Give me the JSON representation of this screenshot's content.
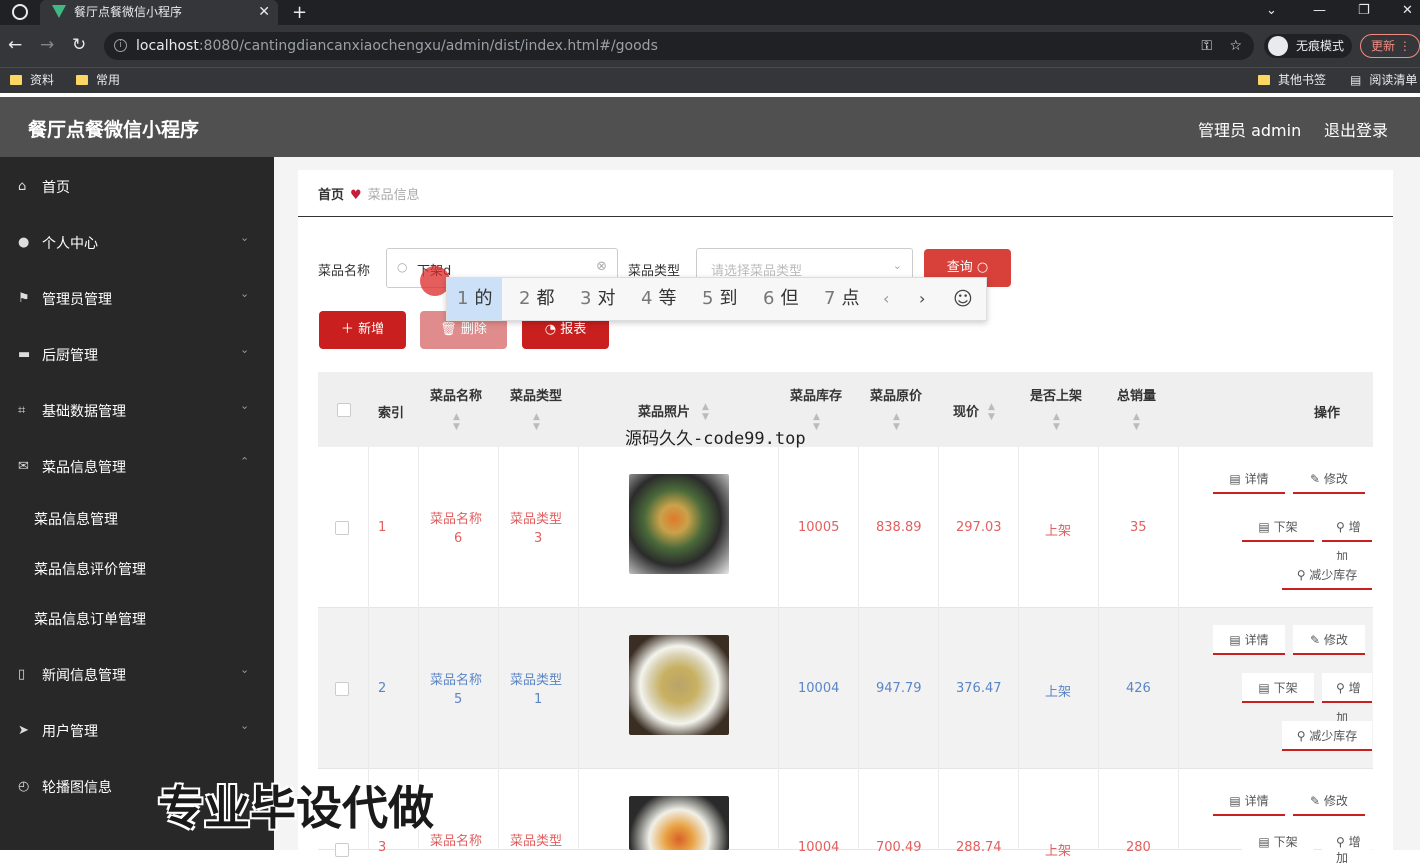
{
  "browser": {
    "tab_title": "餐厅点餐微信小程序",
    "url_host": "localhost",
    "url_rest": ":8080/cantingdiancanxiaochengxu/admin/dist/index.html#/goods",
    "incognito_label": "无痕模式",
    "update_label": "更新",
    "bookmarks": [
      "资料",
      "常用"
    ],
    "bookmarks_right": [
      "其他书签",
      "阅读清单"
    ]
  },
  "header": {
    "title": "餐厅点餐微信小程序",
    "admin": "管理员 admin",
    "logout": "退出登录"
  },
  "sidebar": {
    "items": [
      {
        "label": "首页",
        "icon": "home-icon"
      },
      {
        "label": "个人中心",
        "icon": "user-icon"
      },
      {
        "label": "管理员管理",
        "icon": "flag-icon"
      },
      {
        "label": "后厨管理",
        "icon": "kitchen-icon"
      },
      {
        "label": "基础数据管理",
        "icon": "crop-icon"
      },
      {
        "label": "菜品信息管理",
        "icon": "mail-icon"
      }
    ],
    "subitems": [
      "菜品信息管理",
      "菜品信息评价管理",
      "菜品信息订单管理"
    ],
    "items_after": [
      {
        "label": "新闻信息管理",
        "icon": "phone-icon"
      },
      {
        "label": "用户管理",
        "icon": "send-icon"
      },
      {
        "label": "轮播图信息",
        "icon": "clock-icon"
      }
    ]
  },
  "breadcrumb": {
    "home": "首页",
    "current": "菜品信息"
  },
  "search": {
    "name_label": "菜品名称",
    "name_value": "下架d",
    "type_label": "菜品类型",
    "type_placeholder": "请选择菜品类型",
    "query_button": "查询"
  },
  "ime": {
    "candidates": [
      {
        "num": "1",
        "char": "的"
      },
      {
        "num": "2",
        "char": "都"
      },
      {
        "num": "3",
        "char": "对"
      },
      {
        "num": "4",
        "char": "等"
      },
      {
        "num": "5",
        "char": "到"
      },
      {
        "num": "6",
        "char": "但"
      },
      {
        "num": "7",
        "char": "点"
      }
    ]
  },
  "actions": {
    "add": "新增",
    "delete": "删除",
    "report": "报表"
  },
  "table": {
    "headers": {
      "index": "索引",
      "name": "菜品名称",
      "type": "菜品类型",
      "photo": "菜品照片",
      "stock": "菜品库存",
      "orig_price": "菜品原价",
      "price": "现价",
      "on_shelf": "是否上架",
      "sales": "总销量",
      "ops": "操作"
    },
    "rows": [
      {
        "index": "1",
        "name": "菜品名称",
        "name2": "6",
        "type": "菜品类型",
        "type2": "3",
        "stock": "10005",
        "orig_price": "838.89",
        "price": "297.03",
        "on_shelf": "上架",
        "sales": "35",
        "ops": [
          "详情",
          "修改",
          "下架",
          "增加",
          "减少库存"
        ]
      },
      {
        "index": "2",
        "name": "菜品名称",
        "name2": "5",
        "type": "菜品类型",
        "type2": "1",
        "stock": "10004",
        "orig_price": "947.79",
        "price": "376.47",
        "on_shelf": "上架",
        "sales": "426",
        "ops": [
          "详情",
          "修改",
          "下架",
          "增加",
          "减少库存"
        ]
      },
      {
        "index": "3",
        "name": "菜品名称",
        "name2": "",
        "type": "菜品类型",
        "type2": "",
        "stock": "10004",
        "orig_price": "700.49",
        "price": "288.74",
        "on_shelf": "上架",
        "sales": "280",
        "ops": [
          "详情",
          "修改",
          "下架",
          "增加"
        ]
      }
    ]
  },
  "overlays": {
    "watermark": "源码久久-code99.top",
    "promo": "专业毕设代做"
  },
  "colors": {
    "accent_red": "#c91f1f",
    "sidebar_bg": "#282828",
    "header_bg": "#505050",
    "row_link_red": "#e06060",
    "row_link_blue": "#5b85c5"
  }
}
